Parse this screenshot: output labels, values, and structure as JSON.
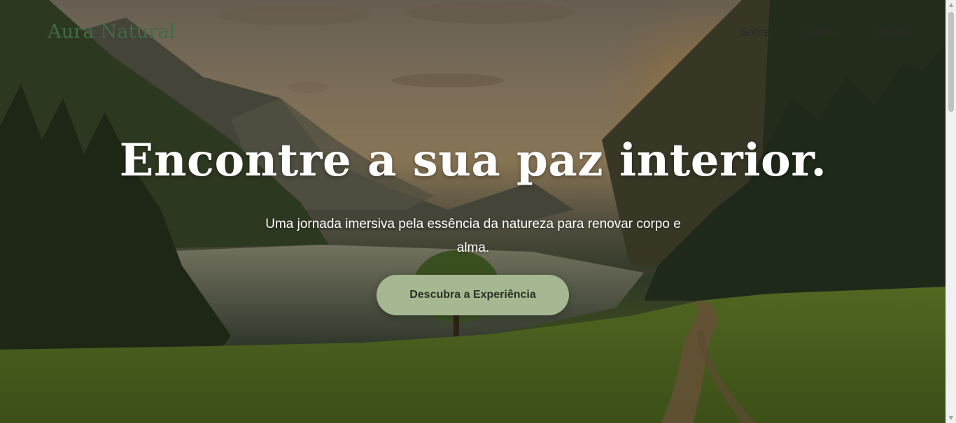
{
  "header": {
    "brand": "Aura Natural",
    "nav": [
      {
        "label": "Sobre"
      },
      {
        "label": "Galeria"
      },
      {
        "label": "Contato"
      }
    ]
  },
  "hero": {
    "headline": "Encontre a sua paz interior.",
    "subtitle": "Uma jornada imersiva pela essência da natureza para renovar corpo e alma.",
    "cta_label": "Descubra a Experiência"
  },
  "colors": {
    "brand": "#3f6b45",
    "cta_background": "#a5b892",
    "cta_text": "#2b3325"
  },
  "icons": {
    "scroll_up": "arrow-up-icon",
    "scroll_down": "arrow-down-icon"
  }
}
